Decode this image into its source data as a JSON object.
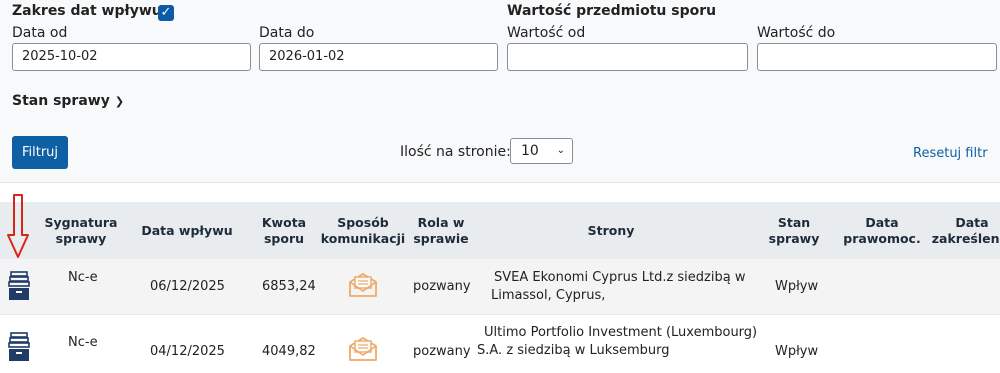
{
  "filters": {
    "date_range_title": "Zakres dat wpływu",
    "date_range_checked": true,
    "date_from_label": "Data od",
    "date_from_value": "2025-10-02",
    "date_to_label": "Data do",
    "date_to_value": "2026-01-02",
    "value_title": "Wartość przedmiotu sporu",
    "value_from_label": "Wartość od",
    "value_from_value": "",
    "value_to_label": "Wartość do",
    "value_to_value": "",
    "case_status_label": "Stan sprawy",
    "filter_button": "Filtruj",
    "per_page_label": "Ilość na stronie:",
    "per_page_value": "10",
    "reset_link": "Resetuj filtr"
  },
  "table": {
    "headers": {
      "signature": "Sygnatura\nsprawy",
      "date": "Data wpływu",
      "amount": "Kwota\nsporu",
      "communication": "Sposób\nkomunikacji",
      "role": "Rola w\nsprawie",
      "parties": "Strony",
      "status": "Stan\nsprawy",
      "final_date": "Data\nprawomoc.",
      "struck_date": "Data\nzakreślenia"
    },
    "rows": [
      {
        "signature": "Nc-e",
        "date": "06/12/2025",
        "amount": "6853,24",
        "role": "pozwany",
        "parties_line1": "SVEA Ekonomi Cyprus Ltd.z siedzibą w",
        "parties_line2": "Limassol, Cyprus,",
        "status": "Wpływ"
      },
      {
        "signature": "Nc-e",
        "date": "04/12/2025",
        "amount": "4049,82",
        "role": "pozwany",
        "parties_line1": "Ultimo Portfolio Investment (Luxembourg)",
        "parties_line2": "S.A. z siedzibą w Luksemburg",
        "status": "Wpływ"
      }
    ]
  },
  "colors": {
    "primary": "#0f5fa5",
    "archive_icon": "#1f3b66",
    "mail_icon": "#f0a868",
    "annotation_arrow": "#d9261c"
  }
}
